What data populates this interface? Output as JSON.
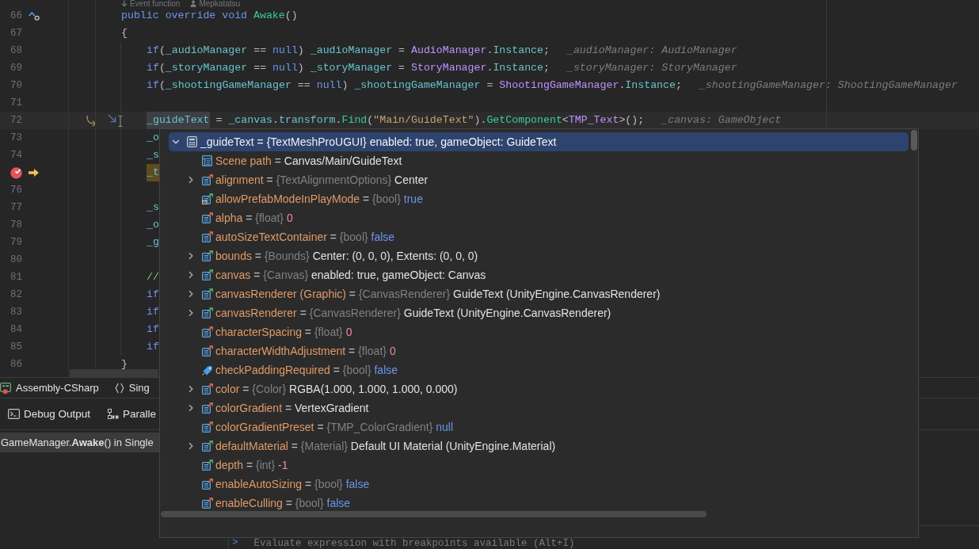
{
  "editor": {
    "code_vision": [
      {
        "text": "Event function",
        "kind": "event"
      },
      {
        "text": "Mepkatatsu",
        "kind": "author"
      }
    ],
    "lines": [
      {
        "number": "66",
        "current": false,
        "breakpoint": false,
        "execution": false,
        "overrides": true,
        "tokens": [
          {
            "text": "public ",
            "kind": "keyword"
          },
          {
            "text": "override ",
            "kind": "keyword"
          },
          {
            "text": "void ",
            "kind": "keyword"
          },
          {
            "text": "Awake",
            "kind": "method"
          },
          {
            "text": "()",
            "kind": "plain"
          }
        ]
      },
      {
        "number": "67",
        "current": false,
        "breakpoint": false,
        "execution": false,
        "overrides": false,
        "tokens": [
          {
            "text": "{",
            "kind": "plain"
          }
        ],
        "children": [
          {
            "number": "68",
            "current": false,
            "breakpoint": false,
            "execution": false,
            "overrides": false,
            "tokens": [
              {
                "text": "if",
                "kind": "keyword"
              },
              {
                "text": "(",
                "kind": "plain"
              },
              {
                "text": "_audioManager",
                "kind": "member"
              },
              {
                "text": " == ",
                "kind": "plain"
              },
              {
                "text": "null",
                "kind": "keyword"
              },
              {
                "text": ") ",
                "kind": "plain"
              },
              {
                "text": "_audioManager",
                "kind": "member"
              },
              {
                "text": " = ",
                "kind": "plain"
              },
              {
                "text": "AudioManager",
                "kind": "type"
              },
              {
                "text": ".",
                "kind": "plain"
              },
              {
                "text": "Instance",
                "kind": "member"
              },
              {
                "text": ";",
                "kind": "plain"
              }
            ],
            "hint": "_audioManager: AudioManager"
          },
          {
            "number": "69",
            "current": false,
            "breakpoint": false,
            "execution": false,
            "overrides": false,
            "tokens": [
              {
                "text": "if",
                "kind": "keyword"
              },
              {
                "text": "(",
                "kind": "plain"
              },
              {
                "text": "_storyManager",
                "kind": "member"
              },
              {
                "text": " == ",
                "kind": "plain"
              },
              {
                "text": "null",
                "kind": "keyword"
              },
              {
                "text": ") ",
                "kind": "plain"
              },
              {
                "text": "_storyManager",
                "kind": "member"
              },
              {
                "text": " = ",
                "kind": "plain"
              },
              {
                "text": "StoryManager",
                "kind": "type"
              },
              {
                "text": ".",
                "kind": "plain"
              },
              {
                "text": "Instance",
                "kind": "member"
              },
              {
                "text": ";",
                "kind": "plain"
              }
            ],
            "hint": "_storyManager: StoryManager"
          },
          {
            "number": "70",
            "current": false,
            "breakpoint": false,
            "execution": false,
            "overrides": false,
            "tokens": [
              {
                "text": "if",
                "kind": "keyword"
              },
              {
                "text": "(",
                "kind": "plain"
              },
              {
                "text": "_shootingGameManager",
                "kind": "member"
              },
              {
                "text": " == ",
                "kind": "plain"
              },
              {
                "text": "null",
                "kind": "keyword"
              },
              {
                "text": ") ",
                "kind": "plain"
              },
              {
                "text": "_shootingGameManager",
                "kind": "member"
              },
              {
                "text": " = ",
                "kind": "plain"
              },
              {
                "text": "ShootingGameManager",
                "kind": "type"
              },
              {
                "text": ".",
                "kind": "plain"
              },
              {
                "text": "Instance",
                "kind": "member"
              },
              {
                "text": ";",
                "kind": "plain"
              }
            ],
            "hint": "_shootingGameManager: ShootingGameManager"
          },
          {
            "number": "71",
            "current": false,
            "breakpoint": false,
            "execution": false,
            "overrides": false
          },
          {
            "number": "72",
            "current": true,
            "breakpoint": false,
            "execution": false,
            "overrides": false,
            "tokens": [
              {
                "text": "_guideText",
                "kind": "member",
                "highlighted": true
              },
              {
                "text": " = ",
                "kind": "plain",
                "highlighted": false
              },
              {
                "text": "_canvas",
                "kind": "member",
                "highlighted": false
              },
              {
                "text": ".",
                "kind": "plain",
                "highlighted": false
              },
              {
                "text": "transform",
                "kind": "member",
                "highlighted": false
              },
              {
                "text": ".",
                "kind": "plain",
                "highlighted": false
              },
              {
                "text": "Find",
                "kind": "method",
                "highlighted": false
              },
              {
                "text": "(",
                "kind": "plain",
                "highlighted": false
              },
              {
                "text": "\"Main/GuideText\"",
                "kind": "string",
                "highlighted": false
              },
              {
                "text": ").",
                "kind": "plain",
                "highlighted": false
              },
              {
                "text": "GetComponent",
                "kind": "method",
                "highlighted": false
              },
              {
                "text": "<",
                "kind": "plain",
                "highlighted": false
              },
              {
                "text": "TMP_Text",
                "kind": "type",
                "highlighted": false
              },
              {
                "text": ">();",
                "kind": "plain",
                "highlighted": false
              }
            ],
            "hint": "_canvas: GameObject"
          },
          {
            "number": "73",
            "current": false,
            "breakpoint": false,
            "execution": false,
            "overrides": false,
            "tokens": [
              {
                "text": "_o",
                "kind": "member"
              }
            ]
          },
          {
            "number": "74",
            "current": false,
            "breakpoint": false,
            "execution": false,
            "overrides": false,
            "tokens": [
              {
                "text": "_s",
                "kind": "member"
              }
            ]
          },
          {
            "current": false,
            "breakpoint": true,
            "execution": true,
            "overrides": false,
            "tokens": [
              {
                "text": "_t",
                "kind": "member"
              }
            ]
          },
          {
            "number": "76",
            "current": false,
            "breakpoint": false,
            "execution": false,
            "overrides": false
          },
          {
            "number": "77",
            "current": false,
            "breakpoint": false,
            "execution": false,
            "overrides": false,
            "tokens": [
              {
                "text": "_s",
                "kind": "member"
              }
            ]
          },
          {
            "number": "78",
            "current": false,
            "breakpoint": false,
            "execution": false,
            "overrides": false,
            "tokens": [
              {
                "text": "_o",
                "kind": "member"
              }
            ]
          },
          {
            "number": "79",
            "current": false,
            "breakpoint": false,
            "execution": false,
            "overrides": false,
            "tokens": [
              {
                "text": "_g",
                "kind": "member"
              }
            ]
          },
          {
            "number": "80",
            "current": false,
            "breakpoint": false,
            "execution": false,
            "overrides": false
          },
          {
            "number": "81",
            "current": false,
            "breakpoint": false,
            "execution": false,
            "overrides": false,
            "tokens": [
              {
                "text": "//",
                "kind": "comment"
              }
            ]
          },
          {
            "number": "82",
            "current": false,
            "breakpoint": false,
            "execution": false,
            "overrides": false,
            "tokens": [
              {
                "text": "if",
                "kind": "keyword"
              }
            ]
          },
          {
            "number": "83",
            "current": false,
            "breakpoint": false,
            "execution": false,
            "overrides": false,
            "tokens": [
              {
                "text": "if",
                "kind": "keyword"
              }
            ]
          },
          {
            "number": "84",
            "current": false,
            "breakpoint": false,
            "execution": false,
            "overrides": false,
            "tokens": [
              {
                "text": "if",
                "kind": "keyword"
              }
            ]
          },
          {
            "number": "85",
            "current": false,
            "breakpoint": false,
            "execution": false,
            "overrides": false,
            "tokens": [
              {
                "text": "if",
                "kind": "keyword"
              }
            ]
          }
        ]
      },
      {
        "number": "86",
        "current": false,
        "breakpoint": false,
        "execution": false,
        "overrides": false,
        "tokens": [
          {
            "text": "}",
            "kind": "plain"
          }
        ]
      }
    ]
  },
  "popup": {
    "items": [
      {
        "name": "_guideText",
        "operator": "=",
        "declared_type": "{TextMeshProUGUI}",
        "value": {
          "text": "enabled: true, gameObject: GuideText",
          "kind": "text"
        },
        "kind": "local",
        "expanded": true,
        "selected": true,
        "children": [
          {
            "name": "Scene path",
            "operator": "=",
            "value": {
              "text": "Canvas/Main/GuideText",
              "kind": "text"
            },
            "kind": "path",
            "selected": false
          },
          {
            "name": "alignment",
            "operator": "=",
            "declared_type": "{TextAlignmentOptions}",
            "value": {
              "text": "Center",
              "kind": "text"
            },
            "kind": "property",
            "expanded": false,
            "selected": false
          },
          {
            "name": "allowPrefabModeInPlayMode",
            "operator": "=",
            "declared_type": "{bool}",
            "value": {
              "text": "true",
              "kind": "keyword"
            },
            "kind": "static-property",
            "selected": false
          },
          {
            "name": "alpha",
            "operator": "=",
            "declared_type": "{float}",
            "value": {
              "text": "0",
              "kind": "number"
            },
            "kind": "property",
            "selected": false
          },
          {
            "name": "autoSizeTextContainer",
            "operator": "=",
            "declared_type": "{bool}",
            "value": {
              "text": "false",
              "kind": "keyword"
            },
            "kind": "property",
            "selected": false
          },
          {
            "name": "bounds",
            "operator": "=",
            "declared_type": "{Bounds}",
            "value": {
              "text": "Center: (0, 0, 0), Extents: (0, 0, 0)",
              "kind": "text"
            },
            "kind": "readonly-property",
            "expanded": false,
            "selected": false
          },
          {
            "name": "canvas",
            "operator": "=",
            "declared_type": "{Canvas}",
            "value": {
              "text": "enabled: true, gameObject: Canvas",
              "kind": "text"
            },
            "kind": "readonly-property",
            "expanded": false,
            "selected": false
          },
          {
            "name": "canvasRenderer (Graphic)",
            "operator": "=",
            "declared_type": "{CanvasRenderer}",
            "value": {
              "text": "GuideText (UnityEngine.CanvasRenderer)",
              "kind": "text"
            },
            "kind": "readonly-property",
            "expanded": false,
            "selected": false
          },
          {
            "name": "canvasRenderer",
            "operator": "=",
            "declared_type": "{CanvasRenderer}",
            "value": {
              "text": "GuideText (UnityEngine.CanvasRenderer)",
              "kind": "text"
            },
            "kind": "readonly-property",
            "expanded": false,
            "selected": false
          },
          {
            "name": "characterSpacing",
            "operator": "=",
            "declared_type": "{float}",
            "value": {
              "text": "0",
              "kind": "number"
            },
            "kind": "property",
            "selected": false
          },
          {
            "name": "characterWidthAdjustment",
            "operator": "=",
            "declared_type": "{float}",
            "value": {
              "text": "0",
              "kind": "number"
            },
            "kind": "property",
            "selected": false
          },
          {
            "name": "checkPaddingRequired",
            "operator": "=",
            "declared_type": "{bool}",
            "value": {
              "text": "false",
              "kind": "keyword"
            },
            "kind": "flag",
            "selected": false
          },
          {
            "name": "color",
            "operator": "=",
            "declared_type": "{Color}",
            "value": {
              "text": "RGBA(1.000, 1.000, 1.000, 0.000)",
              "kind": "text"
            },
            "kind": "property",
            "expanded": false,
            "selected": false
          },
          {
            "name": "colorGradient",
            "operator": "=",
            "value": {
              "text": "VertexGradient",
              "kind": "text"
            },
            "kind": "property",
            "expanded": false,
            "selected": false
          },
          {
            "name": "colorGradientPreset",
            "operator": "=",
            "declared_type": "{TMP_ColorGradient}",
            "value": {
              "text": "null",
              "kind": "keyword"
            },
            "kind": "property",
            "selected": false
          },
          {
            "name": "defaultMaterial",
            "operator": "=",
            "declared_type": "{Material}",
            "value": {
              "text": "Default UI Material (UnityEngine.Material)",
              "kind": "text"
            },
            "kind": "readonly-property",
            "expanded": false,
            "selected": false
          },
          {
            "name": "depth",
            "operator": "=",
            "declared_type": "{int}",
            "value": {
              "text": "-1",
              "kind": "number"
            },
            "kind": "readonly-property",
            "selected": false
          },
          {
            "name": "enableAutoSizing",
            "operator": "=",
            "declared_type": "{bool}",
            "value": {
              "text": "false",
              "kind": "keyword"
            },
            "kind": "property",
            "selected": false
          },
          {
            "name": "enableCulling",
            "operator": "=",
            "declared_type": "{bool}",
            "value": {
              "text": "false",
              "kind": "keyword"
            },
            "kind": "property",
            "selected": false
          }
        ]
      }
    ]
  },
  "breadcrumbs": [
    {
      "text": "Assembly-CSharp",
      "kind": "project"
    },
    {
      "text": "Sing",
      "kind": "namespace"
    }
  ],
  "tool_tabs": [
    {
      "label": "Debug Output",
      "kind": "console",
      "selected": false
    },
    {
      "label": "Paralle",
      "kind": "stacks",
      "selected": false
    }
  ],
  "frames": [
    {
      "text": "GameManager.**Awake**() in Single",
      "selected": true
    }
  ],
  "evaluate": {
    "prompt": ">",
    "placeholder": "Evaluate expression with breakpoints available (Alt+I)"
  }
}
